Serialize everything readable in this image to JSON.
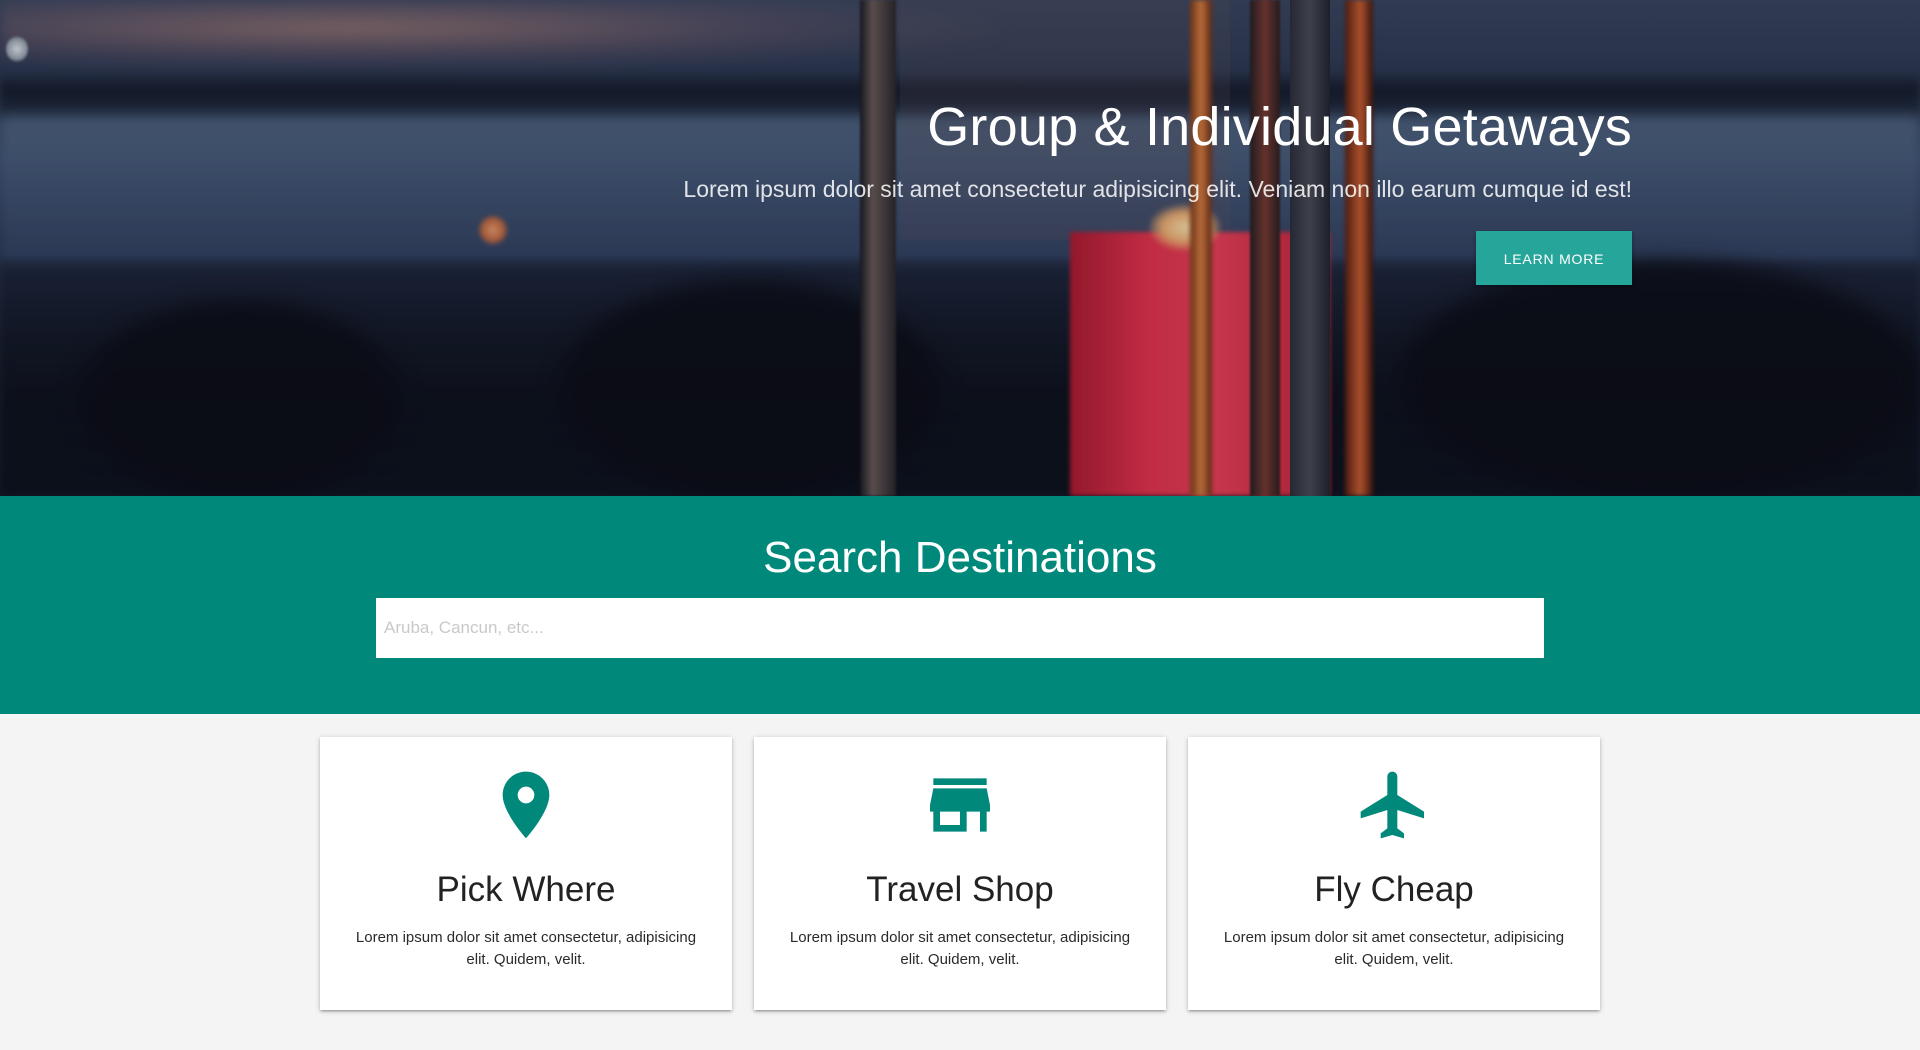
{
  "hero": {
    "title": "Group & Individual Getaways",
    "subtitle": "Lorem ipsum dolor sit amet consectetur adipisicing elit. Veniam non illo earum cumque id est!",
    "button_label": "LEARN MORE"
  },
  "search": {
    "title": "Search Destinations",
    "placeholder": "Aruba, Cancun, etc...",
    "value": ""
  },
  "cards": [
    {
      "icon": "map-pin-icon",
      "title": "Pick Where",
      "text": "Lorem ipsum dolor sit amet consectetur, adipisicing elit. Quidem, velit."
    },
    {
      "icon": "store-icon",
      "title": "Travel Shop",
      "text": "Lorem ipsum dolor sit amet consectetur, adipisicing elit. Quidem, velit."
    },
    {
      "icon": "airplane-icon",
      "title": "Fly Cheap",
      "text": "Lorem ipsum dolor sit amet consectetur, adipisicing elit. Quidem, velit."
    }
  ],
  "colors": {
    "primary": "#00897b",
    "accent": "#26a69a",
    "background": "#f4f4f4",
    "card": "#ffffff"
  }
}
